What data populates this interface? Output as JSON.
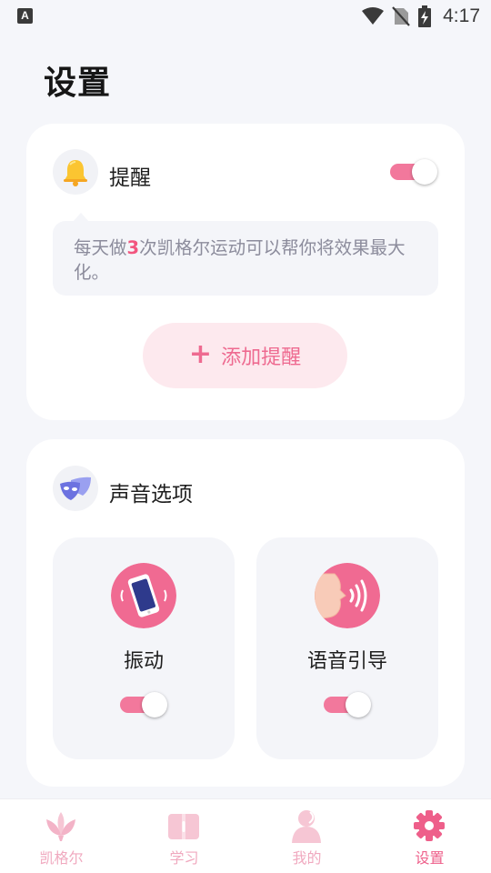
{
  "status_bar": {
    "time": "4:17",
    "notification_letter": "A"
  },
  "page": {
    "title": "设置"
  },
  "reminder": {
    "title": "提醒",
    "toggle_on": true,
    "tip_before": "每天做",
    "tip_count": "3",
    "tip_after": "次凯格尔运动可以帮你将效果最大化。",
    "add_label": "添加提醒"
  },
  "sound": {
    "title": "声音选项",
    "options": [
      {
        "label": "振动",
        "toggle_on": true
      },
      {
        "label": "语音引导",
        "toggle_on": true
      }
    ]
  },
  "nav": {
    "items": [
      {
        "label": "凯格尔",
        "icon": "lotus-icon",
        "active": false
      },
      {
        "label": "学习",
        "icon": "book-icon",
        "active": false
      },
      {
        "label": "我的",
        "icon": "person-icon",
        "active": false
      },
      {
        "label": "设置",
        "icon": "gear-icon",
        "active": true
      }
    ]
  },
  "colors": {
    "accent": "#ee5f8a",
    "toggle": "#f2789c",
    "background": "#f5f6fa"
  }
}
